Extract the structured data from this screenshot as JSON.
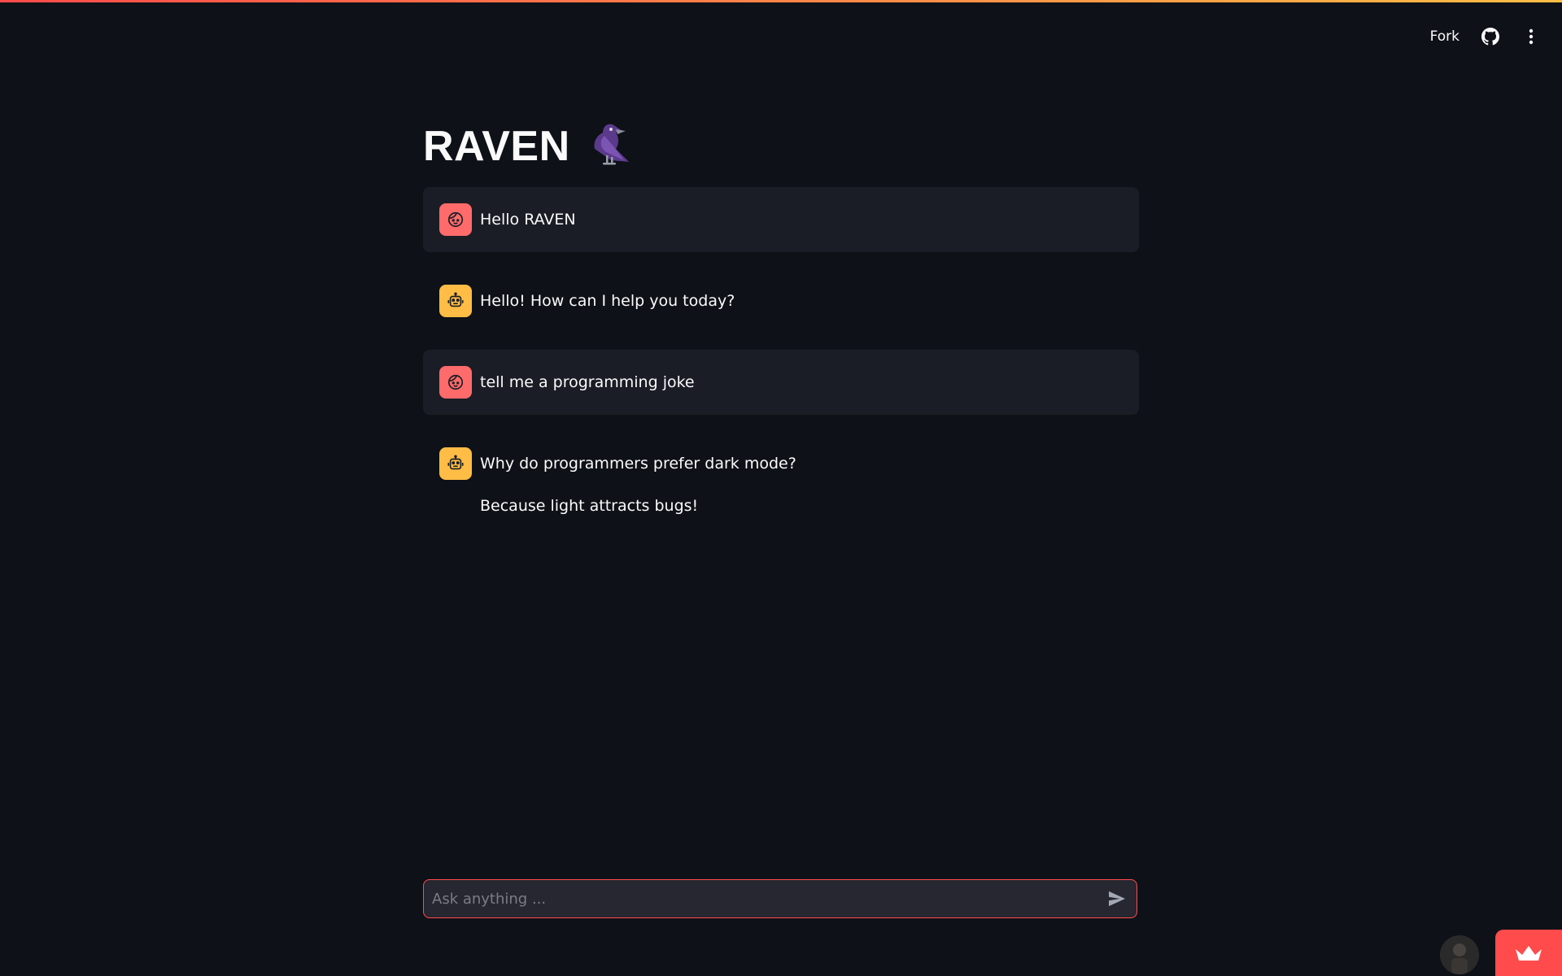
{
  "header": {
    "fork_label": "Fork",
    "github_icon": "github-icon",
    "menu_icon": "vertical-dots-icon",
    "decoration_colors": [
      "#ff4b4b",
      "#ffbd45"
    ]
  },
  "main": {
    "title": "RAVEN",
    "title_icon": "raven-bird-icon"
  },
  "messages": [
    {
      "role": "user",
      "avatar_icon": "user-face-icon",
      "paragraphs": [
        "Hello RAVEN"
      ]
    },
    {
      "role": "assistant",
      "avatar_icon": "robot-icon",
      "paragraphs": [
        "Hello! How can I help you today?"
      ]
    },
    {
      "role": "user",
      "avatar_icon": "user-face-icon",
      "paragraphs": [
        "tell me a programming joke"
      ]
    },
    {
      "role": "assistant",
      "avatar_icon": "robot-icon",
      "paragraphs": [
        "Why do programmers prefer dark mode?",
        "Because light attracts bugs!"
      ]
    }
  ],
  "chat_input": {
    "placeholder": "Ask anything ...",
    "value": "",
    "send_icon": "send-icon"
  },
  "footer": {
    "user_avatar_icon": "user-avatar-icon",
    "hosted_badge_icon": "crown-icon"
  },
  "colors": {
    "background": "#0e1117",
    "user_bubble": "#1b1d26",
    "user_avatar": "#ff6b6b",
    "assistant_avatar": "#ffbd45",
    "accent": "#ff4b4b"
  }
}
